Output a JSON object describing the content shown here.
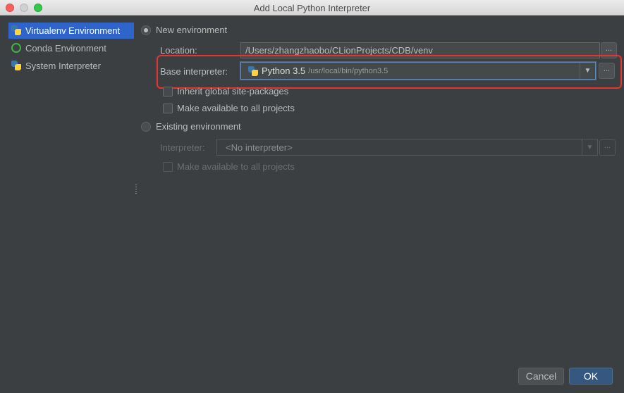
{
  "window": {
    "title": "Add Local Python Interpreter"
  },
  "sidebar": {
    "items": [
      {
        "label": "Virtualenv Environment",
        "icon": "python-icon",
        "selected": true
      },
      {
        "label": "Conda Environment",
        "icon": "conda-icon",
        "selected": false
      },
      {
        "label": "System Interpreter",
        "icon": "python-icon",
        "selected": false
      }
    ]
  },
  "new_env": {
    "radio_label": "New environment",
    "selected": true,
    "location_label": "Location:",
    "location_value": "/Users/zhangzhaobo/CLionProjects/CDB/venv",
    "base_label": "Base interpreter:",
    "base_version": "Python 3.5",
    "base_path": "/usr/local/bin/python3.5",
    "inherit_label": "Inherit global site-packages",
    "make_available_label": "Make available to all projects",
    "browse_label": "..."
  },
  "existing_env": {
    "radio_label": "Existing environment",
    "selected": false,
    "interpreter_label": "Interpreter:",
    "interpreter_value": "<No interpreter>",
    "make_available_label": "Make available to all projects",
    "browse_label": "..."
  },
  "footer": {
    "cancel_label": "Cancel",
    "ok_label": "OK"
  },
  "colors": {
    "highlight": "#e8332e",
    "selection": "#2f65ca",
    "ok_button": "#365880"
  }
}
